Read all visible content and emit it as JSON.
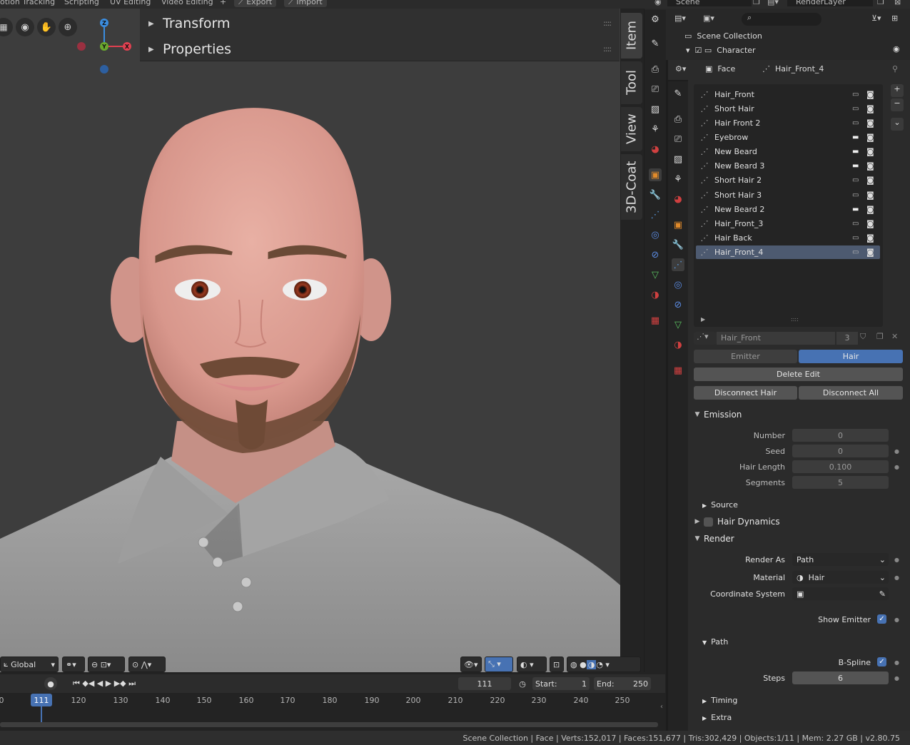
{
  "workspaces": [
    "otion Tracking",
    "Scripting",
    "UV Editing",
    "Video Editing",
    "+",
    "Export",
    "Import"
  ],
  "scene": {
    "name": "Scene",
    "view_layer": "RenderLayer"
  },
  "viewport": {
    "n_panel": {
      "sections": [
        {
          "label": "Transform"
        },
        {
          "label": "Properties"
        }
      ]
    },
    "side_tabs": [
      {
        "label": "Item"
      },
      {
        "label": "Tool"
      },
      {
        "label": "View"
      },
      {
        "label": "3D-Coat"
      }
    ],
    "gizmo": {
      "z": "Z",
      "y": "Y",
      "x": "X"
    },
    "header": {
      "orientation": "Global"
    }
  },
  "outliner": {
    "items": [
      {
        "label": "Scene Collection"
      },
      {
        "label": "Character"
      }
    ]
  },
  "properties_header": {
    "object": "Face",
    "particle_system": "Hair_Front_4"
  },
  "particle_list": [
    {
      "name": "Hair_Front"
    },
    {
      "name": "Short Hair"
    },
    {
      "name": "Hair Front 2"
    },
    {
      "name": "Eyebrow"
    },
    {
      "name": "New Beard"
    },
    {
      "name": "New Beard 3"
    },
    {
      "name": "Short Hair 2"
    },
    {
      "name": "Short Hair 3"
    },
    {
      "name": "New Beard 2"
    },
    {
      "name": "Hair_Front_3"
    },
    {
      "name": "Hair Back"
    },
    {
      "name": "Hair_Front_4"
    }
  ],
  "particle_settings": {
    "name": "Hair_Front",
    "users": "3"
  },
  "type_tabs": {
    "emitter": "Emitter",
    "hair": "Hair"
  },
  "buttons": {
    "delete_edit": "Delete Edit",
    "disconnect_hair": "Disconnect Hair",
    "disconnect_all": "Disconnect All"
  },
  "emission": {
    "title": "Emission",
    "number_label": "Number",
    "number": "0",
    "seed_label": "Seed",
    "seed": "0",
    "length_label": "Hair Length",
    "length": "0.100",
    "segments_label": "Segments",
    "segments": "5",
    "source": "Source"
  },
  "hair_dynamics": {
    "title": "Hair Dynamics"
  },
  "render": {
    "title": "Render",
    "render_as_label": "Render As",
    "render_as": "Path",
    "material_label": "Material",
    "material": "Hair",
    "coord_label": "Coordinate System",
    "show_emitter": "Show Emitter",
    "path": "Path",
    "bspline": "B-Spline",
    "steps_label": "Steps",
    "steps": "6",
    "timing": "Timing",
    "extra": "Extra"
  },
  "timeline": {
    "current_frame": "111",
    "start_label": "Start:",
    "start": "1",
    "end_label": "End:",
    "end": "250",
    "ticks": [
      "0",
      "111",
      "120",
      "130",
      "140",
      "150",
      "160",
      "170",
      "180",
      "190",
      "200",
      "210",
      "220",
      "230",
      "240",
      "250"
    ]
  },
  "status": "Scene Collection | Face | Verts:152,017 | Faces:151,677 | Tris:302,429 | Objects:1/11 | Mem: 2.27 GB | v2.80.75"
}
